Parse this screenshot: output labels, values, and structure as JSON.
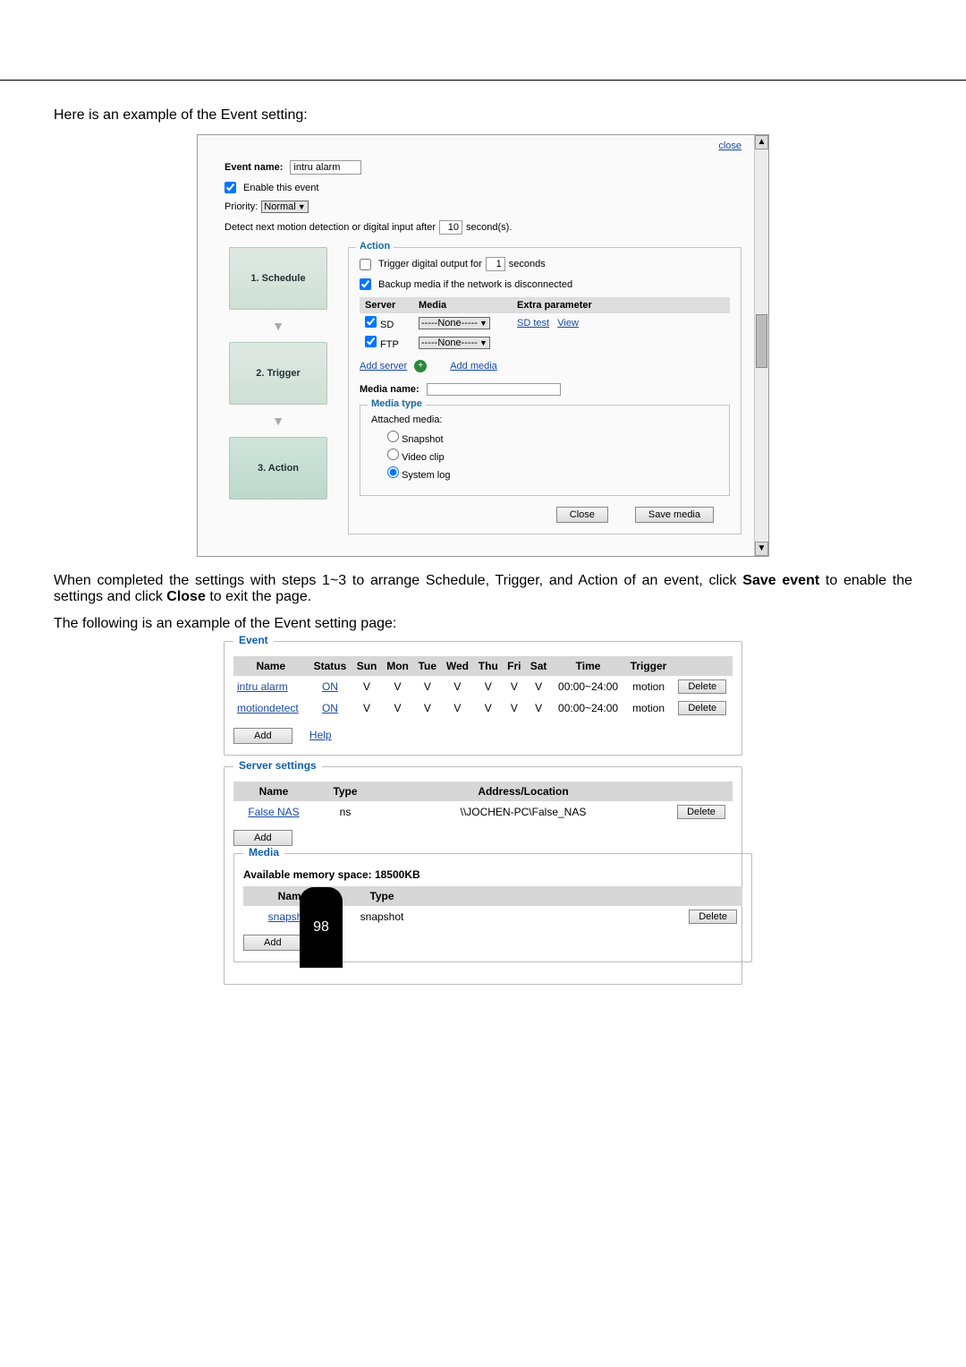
{
  "intro": "Here is an example of the Event setting:",
  "screenshot": {
    "close": "close",
    "event_name_label": "Event name:",
    "event_name_value": "intru alarm",
    "enable_event": "Enable this event",
    "priority_label": "Priority:",
    "priority_value": "Normal",
    "detect_before": "Detect next motion detection or digital input after",
    "detect_value": "10",
    "detect_after": "second(s).",
    "steps": {
      "s1": "1.  Schedule",
      "s2": "2.  Trigger",
      "s3": "3.  Action"
    },
    "action": {
      "legend": "Action",
      "trigger_do_before": "Trigger digital output for",
      "trigger_do_value": "1",
      "trigger_do_after": "seconds",
      "backup": "Backup media if the network is disconnected",
      "hdr_server": "Server",
      "hdr_media": "Media",
      "hdr_extra": "Extra parameter",
      "sd": "SD",
      "ftp": "FTP",
      "media_none": "-----None-----",
      "sd_test": "SD test",
      "view": "View",
      "add_server": "Add server",
      "add_media": "Add media",
      "media_name_label": "Media name:",
      "media_type_legend": "Media type",
      "attached": "Attached media:",
      "snapshot": "Snapshot",
      "video_clip": "Video clip",
      "system_log": "System log",
      "close_btn": "Close",
      "save_media_btn": "Save media"
    }
  },
  "para1": "When completed the settings with steps 1~3 to arrange Schedule, Trigger, and Action of an event, click",
  "para1_bold": "Save event",
  "para1_mid": " to enable the settings and click ",
  "para1_bold2": "Close",
  "para1_end": " to exit the page.",
  "para2": "The following is an example of the Event setting page:",
  "event": {
    "legend": "Event",
    "headers": [
      "Name",
      "Status",
      "Sun",
      "Mon",
      "Tue",
      "Wed",
      "Thu",
      "Fri",
      "Sat",
      "Time",
      "Trigger",
      ""
    ],
    "rows": [
      {
        "name": "intru alarm",
        "status": "ON",
        "days": [
          "V",
          "V",
          "V",
          "V",
          "V",
          "V",
          "V"
        ],
        "time": "00:00~24:00",
        "trigger": "motion",
        "del": "Delete"
      },
      {
        "name": "motiondetect",
        "status": "ON",
        "days": [
          "V",
          "V",
          "V",
          "V",
          "V",
          "V",
          "V"
        ],
        "time": "00:00~24:00",
        "trigger": "motion",
        "del": "Delete"
      }
    ],
    "add": "Add",
    "help": "Help"
  },
  "server": {
    "legend": "Server settings",
    "headers": [
      "Name",
      "Type",
      "Address/Location",
      ""
    ],
    "row": {
      "name": "False NAS",
      "type": "ns",
      "addr": "\\\\JOCHEN-PC\\False_NAS",
      "del": "Delete"
    },
    "add": "Add"
  },
  "media": {
    "legend": "Media",
    "mem": "Available memory space: 18500KB",
    "headers": [
      "Name",
      "Type",
      ""
    ],
    "row": {
      "name": "snapshots",
      "type": "snapshot",
      "del": "Delete"
    },
    "add": "Add"
  },
  "page_number": "98"
}
